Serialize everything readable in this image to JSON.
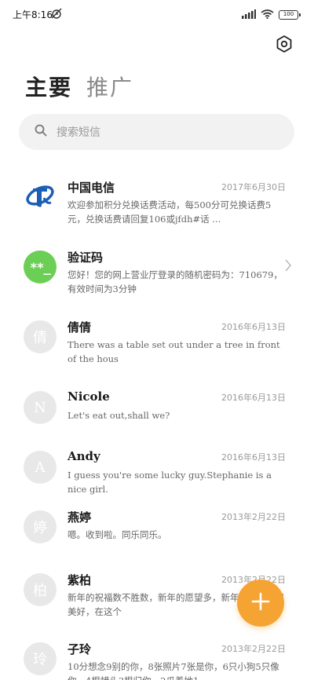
{
  "status": {
    "time": "上午8:16",
    "battery": "100"
  },
  "header": {
    "tab_primary": "主要",
    "tab_secondary": "推广"
  },
  "search": {
    "placeholder": "搜索短信"
  },
  "colors": {
    "accent": "#f5a433",
    "verify_green": "#6bcf55",
    "telecom_blue": "#1a5fb4"
  },
  "messages": [
    {
      "name": "中国电信",
      "date": "2017年6月30日",
      "preview": "欢迎参加积分兑换话费活动，每500分可兑换话费5元，兑换话费请回复106或jfdh#话 ...",
      "avatar": "telecom-logo"
    },
    {
      "name": "验证码",
      "date": "",
      "preview": "您好！您的网上营业厅登录的随机密码为：710679，有效时间为3分钟",
      "avatar_text": "**_"
    },
    {
      "name": "倩倩",
      "date": "2016年6月13日",
      "preview": "There was a table set out under a tree in front of the hous",
      "avatar_text": "倩"
    },
    {
      "name": "Nicole",
      "date": "2016年6月13日",
      "preview": "Let's eat out,shall we?",
      "avatar_text": "N"
    },
    {
      "name": "Andy",
      "date": "2016年6月13日",
      "preview": "I guess you're some lucky guy.Stephanie is a nice girl.",
      "avatar_text": "A"
    },
    {
      "name": "燕婷",
      "date": "2013年2月22日",
      "preview": "嗯。收到啦。同乐同乐。",
      "avatar_text": "婷"
    },
    {
      "name": "紫柏",
      "date": "2013年2月22日",
      "preview": "新年的祝福数不胜数，新年的愿望多，新年的问候依旧美好，在这个",
      "avatar_text": "柏"
    },
    {
      "name": "子玲",
      "date": "2013年2月22日",
      "preview": "10分想念9别的你，8张照片7张是你，6只小狗5只像你，4根蜡头3根归你，2爪着她1 ...",
      "avatar_text": "玲"
    }
  ]
}
